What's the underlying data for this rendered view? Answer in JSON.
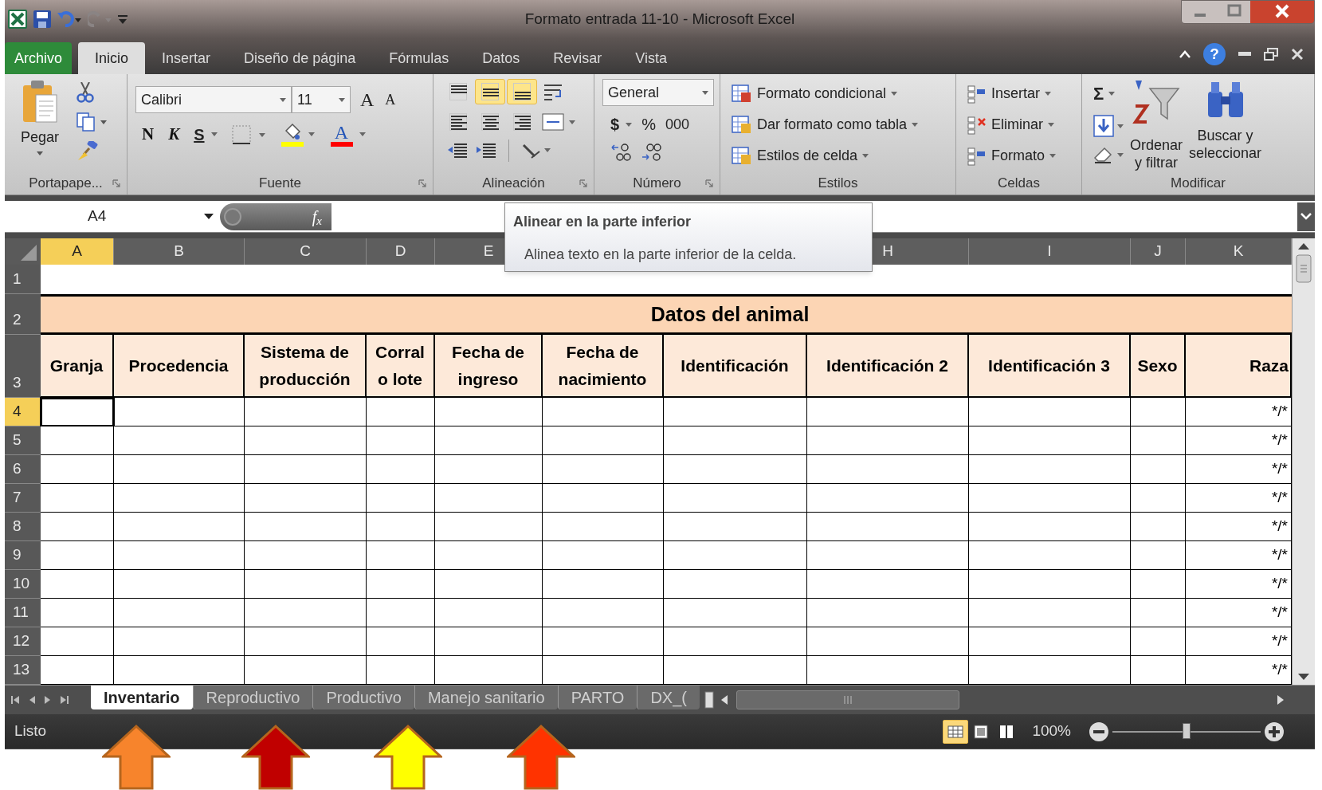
{
  "window": {
    "title": "Formato entrada 11-10  -  Microsoft Excel"
  },
  "ribbon_tabs": [
    {
      "label": "Archivo",
      "kind": "file",
      "selected": false
    },
    {
      "label": "Inicio",
      "kind": "tab",
      "selected": true
    },
    {
      "label": "Insertar",
      "kind": "tab",
      "selected": false
    },
    {
      "label": "Diseño de página",
      "kind": "tab",
      "selected": false
    },
    {
      "label": "Fórmulas",
      "kind": "tab",
      "selected": false
    },
    {
      "label": "Datos",
      "kind": "tab",
      "selected": false
    },
    {
      "label": "Revisar",
      "kind": "tab",
      "selected": false
    },
    {
      "label": "Vista",
      "kind": "tab",
      "selected": false
    }
  ],
  "help": "?",
  "clipboard": {
    "group": "Portapape...",
    "paste": "Pegar"
  },
  "font": {
    "group": "Fuente",
    "name": "Calibri",
    "size": "11",
    "grow": "A",
    "shrink": "A",
    "bold": "N",
    "italic": "K",
    "underline": "S",
    "color_letter": "A"
  },
  "alignment": {
    "group": "Alineación",
    "buttons": [
      {
        "kind": "top",
        "selected": false
      },
      {
        "kind": "middle",
        "selected": true
      },
      {
        "kind": "bottom",
        "selected": true
      },
      {
        "kind": "left",
        "selected": false
      },
      {
        "kind": "center",
        "selected": false
      },
      {
        "kind": "right",
        "selected": false
      }
    ]
  },
  "number": {
    "group": "Número",
    "format": "General",
    "currency": "$",
    "percent": "%",
    "thousands": "000"
  },
  "styles": {
    "group": "Estilos",
    "items": [
      "Formato condicional",
      "Dar formato como tabla",
      "Estilos de celda"
    ]
  },
  "cells": {
    "group": "Celdas",
    "items": [
      "Insertar",
      "Eliminar",
      "Formato"
    ]
  },
  "editing": {
    "group": "Modificar",
    "sum": "Σ",
    "sort": [
      "Ordenar",
      "y filtrar"
    ],
    "find": [
      "Buscar y",
      "seleccionar"
    ]
  },
  "formula_bar": {
    "name_box": "A4",
    "fx": "f$_{x}$"
  },
  "tooltip": {
    "title": "Alinear en la parte inferior",
    "body": "Alinea texto en la parte inferior de la celda."
  },
  "columns": [
    {
      "letter": "A",
      "selected": true
    },
    {
      "letter": "B",
      "selected": false
    },
    {
      "letter": "C",
      "selected": false
    },
    {
      "letter": "D",
      "selected": false
    },
    {
      "letter": "E",
      "selected": false
    },
    {
      "letter": "H",
      "selected": false
    },
    {
      "letter": "I",
      "selected": false
    },
    {
      "letter": "J",
      "selected": false
    },
    {
      "letter": "K",
      "selected": false
    }
  ],
  "rows": [
    {
      "number": "1",
      "selected": false
    },
    {
      "number": "2",
      "selected": false,
      "title": "Datos del animal"
    },
    {
      "number": "3",
      "selected": false,
      "headers": [
        "Granja",
        "Procedencia",
        "Sistema de producción",
        "Corral o lote",
        "Fecha de ingreso",
        "Fecha de nacimiento",
        "Identificación",
        "Identificación 2",
        "Identificación 3",
        "Sexo",
        "Raza"
      ]
    },
    {
      "number": "4",
      "selected": true,
      "k": "*/*"
    },
    {
      "number": "5",
      "selected": false,
      "k": "*/*"
    },
    {
      "number": "6",
      "selected": false,
      "k": "*/*"
    },
    {
      "number": "7",
      "selected": false,
      "k": "*/*"
    },
    {
      "number": "8",
      "selected": false,
      "k": "*/*"
    },
    {
      "number": "9",
      "selected": false,
      "k": "*/*"
    },
    {
      "number": "10",
      "selected": false,
      "k": "*/*"
    },
    {
      "number": "11",
      "selected": false,
      "k": "*/*"
    },
    {
      "number": "12",
      "selected": false,
      "k": "*/*"
    },
    {
      "number": "13",
      "selected": false,
      "k": "*/*"
    }
  ],
  "sheet_tabs": [
    {
      "label": "Inventario",
      "selected": true
    },
    {
      "label": "Reproductivo",
      "selected": false
    },
    {
      "label": "Productivo",
      "selected": false
    },
    {
      "label": "Manejo sanitario",
      "selected": false
    },
    {
      "label": "PARTO",
      "selected": false
    },
    {
      "label": "DX_(",
      "selected": false
    }
  ],
  "status_bar": {
    "state": "Listo",
    "views": [
      {
        "kind": "normal",
        "selected": true
      },
      {
        "kind": "layout",
        "selected": false
      },
      {
        "kind": "pagebreak",
        "selected": false
      }
    ],
    "zoom": "100%",
    "level": 0.5
  },
  "annotations": [
    {
      "color": "#f7842c"
    },
    {
      "color": "#c00000"
    },
    {
      "color": "#ffff00"
    },
    {
      "color": "#ff3300"
    }
  ]
}
